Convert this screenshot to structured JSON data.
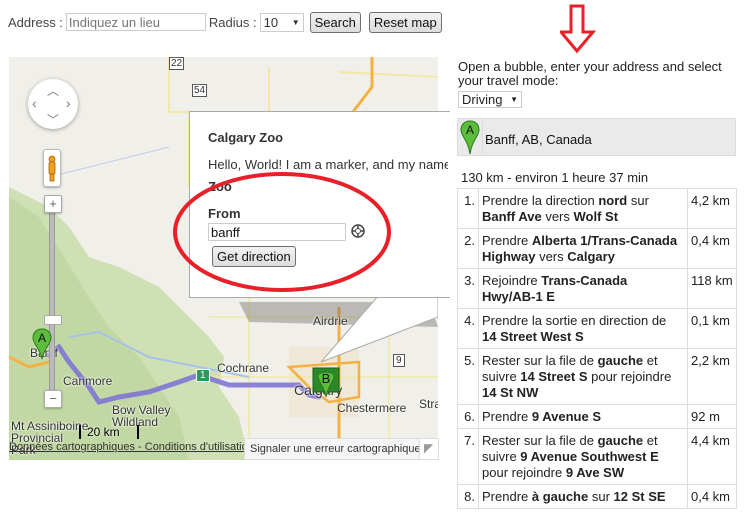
{
  "toolbar": {
    "address_label": "Address :",
    "address_placeholder": "Indiquez un lieu",
    "radius_label": "Radius :",
    "radius_value": "10",
    "search_label": "Search",
    "reset_label": "Reset map"
  },
  "map": {
    "places": [
      "Airdrie",
      "Cochrane",
      "Calgary",
      "Chestermere",
      "Canmore",
      "Banff",
      "Bow Valley Wildland",
      "Mt Assiniboine Provincial Park",
      "Strath"
    ],
    "highway_shields": [
      "22",
      "54",
      "9",
      "1",
      "22"
    ],
    "scale_label": "20 km",
    "marker_a": "A",
    "marker_b": "B",
    "route_color": "#7b6fd6",
    "footer_links": "Données cartographiques - Conditions d'utilisation",
    "report_error": "Signaler une erreur cartographique"
  },
  "bubble": {
    "title": "Calgary Zoo",
    "text": "Hello, World! I am a marker, and my name is Calgary",
    "text_line2": "Zoo",
    "from_label": "From",
    "from_value": "banff",
    "get_direction_label": "Get direction"
  },
  "annotation": {
    "color": "#e8202a"
  },
  "panel": {
    "instructions": "Open a bubble, enter your address and select your travel mode:",
    "travel_mode": "Driving",
    "start_marker": "A",
    "start_address": "Banff, AB, Canada",
    "summary": "130 km - environ 1 heure 37 min",
    "steps": [
      {
        "num": "1.",
        "html": "Prendre la direction <b>nord</b> sur <b>Banff Ave</b> vers <b>Wolf St</b>",
        "dist": "4,2 km"
      },
      {
        "num": "2.",
        "html": "Prendre <b>Alberta 1/Trans-Canada Highway</b> vers <b>Calgary</b>",
        "dist": "0,4 km"
      },
      {
        "num": "3.",
        "html": "Rejoindre <b>Trans-Canada Hwy/AB-1 E</b>",
        "dist": "118 km"
      },
      {
        "num": "4.",
        "html": "Prendre la sortie en direction de <b>14 Street West S</b>",
        "dist": "0,1 km"
      },
      {
        "num": "5.",
        "html": "Rester sur la file de <b>gauche</b> et suivre <b>14 Street S</b> pour rejoindre <b>14 St NW</b>",
        "dist": "2,2 km"
      },
      {
        "num": "6.",
        "html": "Prendre <b>9 Avenue S</b>",
        "dist": "92 m"
      },
      {
        "num": "7.",
        "html": "Rester sur la file de <b>gauche</b> et suivre <b>9 Avenue Southwest E</b> pour rejoindre <b>9 Ave SW</b>",
        "dist": "4,4 km"
      },
      {
        "num": "8.",
        "html": "Prendre <b>à gauche</b> sur <b>12 St SE</b>",
        "dist": "0,4 km"
      }
    ]
  }
}
